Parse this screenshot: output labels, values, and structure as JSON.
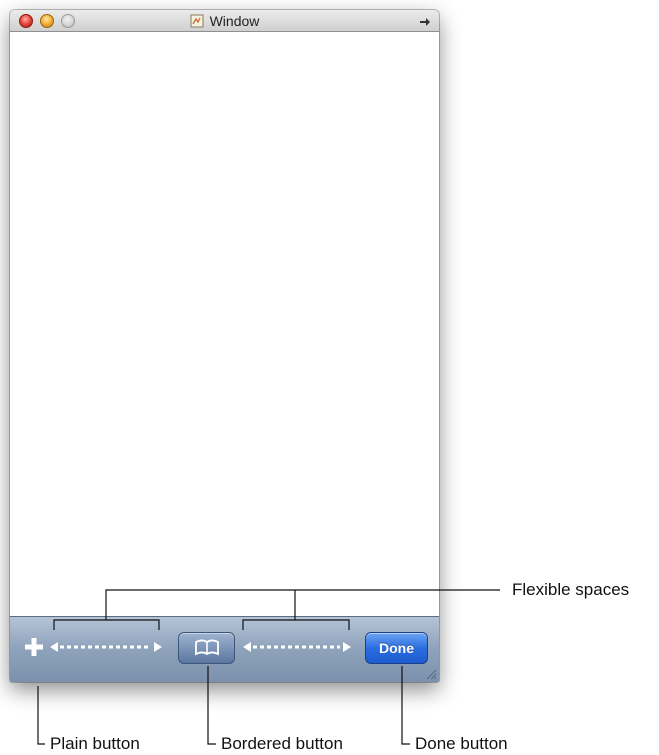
{
  "window": {
    "title": "Window",
    "icons": {
      "close": "close-button",
      "minimize": "minimize-button",
      "zoom": "zoom-button",
      "document": "document-proxy-icon",
      "toolbar_toggle": "toolbar-toggle-icon"
    }
  },
  "toolbar": {
    "plain_button_icon": "plus-icon",
    "bordered_button_icon": "book-icon",
    "done_label": "Done"
  },
  "callouts": {
    "flexible_spaces": "Flexible spaces",
    "plain_button": "Plain button",
    "bordered_button": "Bordered button",
    "done_button": "Done button"
  },
  "colors": {
    "toolbar_top": "#b5c3d6",
    "toolbar_bottom": "#7b91ad",
    "done_blue": "#2a6ee0",
    "bordered_blue": "#5a77a0"
  }
}
